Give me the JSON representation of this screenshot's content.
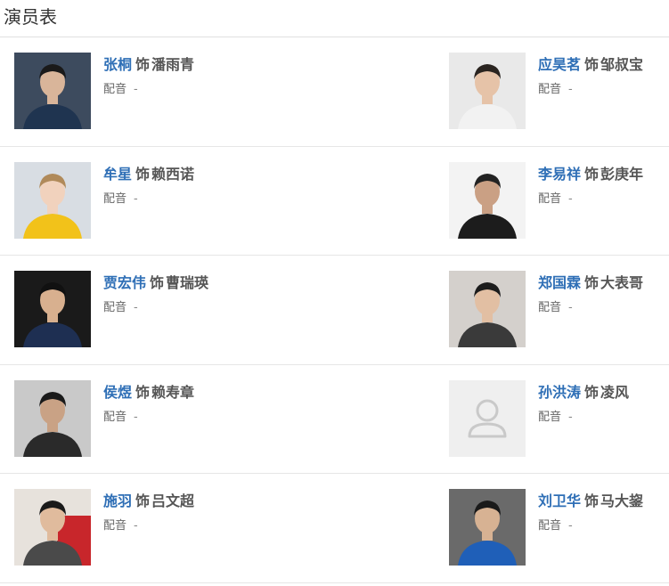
{
  "section_title": "演员表",
  "cast": [
    {
      "actor": "张桐",
      "as": "饰",
      "role": "潘雨青",
      "dub_label": "配音",
      "dub_value": "-",
      "bg": "#3d4b5e",
      "skin": "#d9b59a",
      "shirt": "#1f3450",
      "hair": "#1a1a1a"
    },
    {
      "actor": "应昊茗",
      "as": "饰",
      "role": "邹叔宝",
      "dub_label": "配音",
      "dub_value": "-",
      "bg": "#e9e9e9",
      "skin": "#e6c3a8",
      "shirt": "#f2f2f2",
      "hair": "#2a2420"
    },
    {
      "actor": "牟星",
      "as": "饰",
      "role": "赖西诺",
      "dub_label": "配音",
      "dub_value": "-",
      "bg": "#d8dde3",
      "skin": "#f1d2bd",
      "shirt": "#f2c21a",
      "hair": "#b08a5a"
    },
    {
      "actor": "李易祥",
      "as": "饰",
      "role": "彭庚年",
      "dub_label": "配音",
      "dub_value": "-",
      "bg": "#f3f3f3",
      "skin": "#caa084",
      "shirt": "#1c1c1c",
      "hair": "#222"
    },
    {
      "actor": "贾宏伟",
      "as": "饰",
      "role": "曹瑞瑛",
      "dub_label": "配音",
      "dub_value": "-",
      "bg": "#1a1a1a",
      "skin": "#d8b08f",
      "shirt": "#1e2f52",
      "hair": "#111"
    },
    {
      "actor": "郑国霖",
      "as": "饰",
      "role": "大表哥",
      "dub_label": "配音",
      "dub_value": "-",
      "bg": "#d4d0cc",
      "skin": "#e2bfa3",
      "shirt": "#3a3a3a",
      "hair": "#1c1c1c"
    },
    {
      "actor": "侯煜",
      "as": "饰",
      "role": "赖寿章",
      "dub_label": "配音",
      "dub_value": "-",
      "bg": "#c9c9c9",
      "skin": "#c9a285",
      "shirt": "#2a2a2a",
      "hair": "#1a1a1a"
    },
    {
      "actor": "孙洪涛",
      "as": "饰",
      "role": "凌风",
      "dub_label": "配音",
      "dub_value": "-",
      "placeholder": true
    },
    {
      "actor": "施羽",
      "as": "饰",
      "role": "吕文超",
      "dub_label": "配音",
      "dub_value": "-",
      "bg": "#e7e2dc",
      "skin": "#e0bb9d",
      "shirt": "#4a4a4a",
      "hair": "#1a1a1a",
      "accent": "#c8262b"
    },
    {
      "actor": "刘卫华",
      "as": "饰",
      "role": "马大鋆",
      "dub_label": "配音",
      "dub_value": "-",
      "bg": "#6a6a6a",
      "skin": "#d7b293",
      "shirt": "#1f5fb8",
      "hair": "#1a1a1a"
    }
  ]
}
